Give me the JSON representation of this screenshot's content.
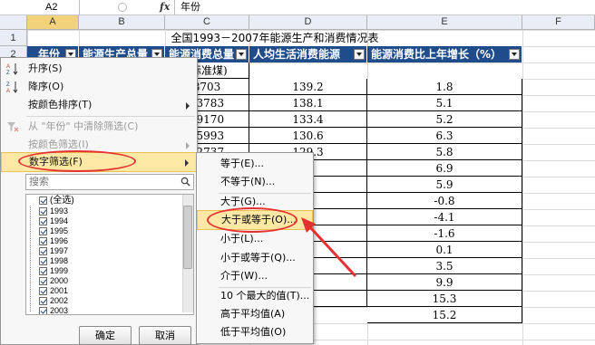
{
  "formula_bar": {
    "name_box": "A2",
    "fx": "fx",
    "content": "年份"
  },
  "columns": [
    "A",
    "B",
    "C",
    "D",
    "E",
    "F"
  ],
  "rows": [
    "1",
    "2"
  ],
  "sheet": {
    "title": "全国1993－2007年能源生产和消费情况表",
    "headers": [
      "年份",
      "能源生产总量",
      "能源消费总量",
      "人均生活消费能源",
      "能源消费比上年增长（%）"
    ],
    "subheader": "(标准煤)",
    "col_c": [
      "8703",
      "03783",
      "09170",
      "15993",
      "22737"
    ],
    "col_d": [
      "139.2",
      "138.1",
      "133.4",
      "130.6",
      "129.3",
      ".8",
      "5",
      ".1",
      ".9",
      ".1",
      ".1",
      ".3",
      "3",
      ".5"
    ],
    "col_e": [
      "1.8",
      "5.1",
      "5.2",
      "6.3",
      "5.8",
      "6.9",
      "5.9",
      "-0.8",
      "-4.1",
      "-1.6",
      "0.1",
      "3.5",
      "9.9",
      "15.3",
      "15.2"
    ]
  },
  "menu": {
    "sort_asc": "升序(S)",
    "sort_desc": "降序(O)",
    "sort_color": "按颜色排序(T)",
    "clear_filter": "从 \"年份\" 中清除筛选(C)",
    "color_filter": "按颜色筛选(I)",
    "number_filter": "数字筛选(F)",
    "search_placeholder": "搜索",
    "select_all": "(全选)",
    "years": [
      "1993",
      "1994",
      "1995",
      "1996",
      "1997",
      "1998",
      "1999",
      "2000",
      "2001",
      "2002",
      "2003"
    ],
    "ok": "确定",
    "cancel": "取消"
  },
  "submenu": {
    "items": [
      "等于(E)...",
      "不等于(N)...",
      "大于(G)...",
      "大于或等于(O)...",
      "小于(L)...",
      "小于或等于(Q)...",
      "介于(W)...",
      "10 个最大的值(T)...",
      "高于平均值(A)",
      "低于平均值(O)"
    ]
  },
  "colors": {
    "header_bg": "#1f4c8a",
    "highlight": "#fde8a6",
    "annotation": "#e53131"
  }
}
